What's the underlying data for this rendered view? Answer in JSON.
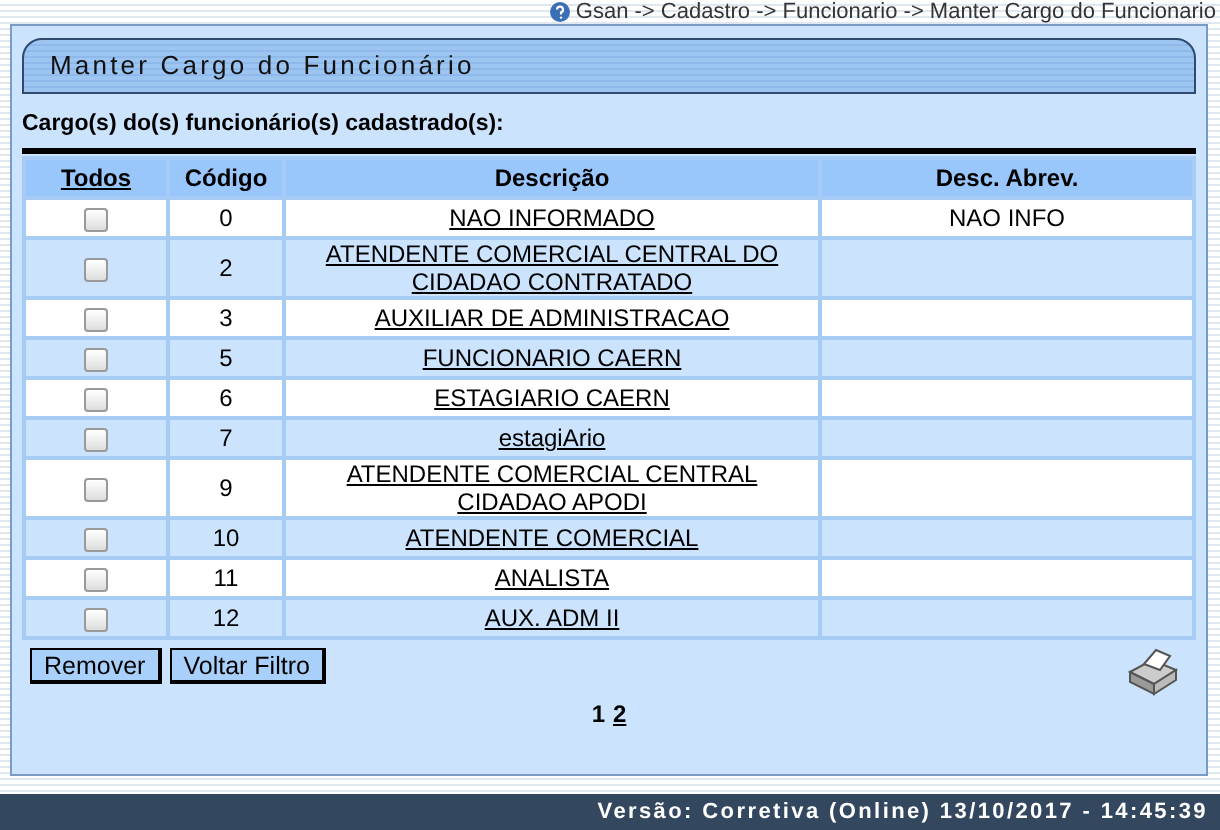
{
  "breadcrumb": "Gsan -> Cadastro -> Funcionario -> Manter Cargo do Funcionario",
  "title": "Manter Cargo do Funcionário",
  "subtitle": "Cargo(s) do(s) funcionário(s) cadastrado(s):",
  "table": {
    "columns": [
      "Todos",
      "Código",
      "Descrição",
      "Desc. Abrev."
    ],
    "rows": [
      {
        "checked": false,
        "code": "0",
        "description": "NAO INFORMADO",
        "abbrev": "NAO INFO"
      },
      {
        "checked": false,
        "code": "2",
        "description": "ATENDENTE COMERCIAL CENTRAL DO CIDADAO CONTRATADO"
      },
      {
        "checked": false,
        "code": "3",
        "description": "AUXILIAR DE ADMINISTRACAO"
      },
      {
        "checked": false,
        "code": "5",
        "description": "FUNCIONARIO CAERN"
      },
      {
        "checked": false,
        "code": "6",
        "description": "ESTAGIARIO CAERN"
      },
      {
        "checked": false,
        "code": "7",
        "description": "estagiArio"
      },
      {
        "checked": false,
        "code": "9",
        "description": "ATENDENTE COMERCIAL CENTRAL CIDADAO APODI"
      },
      {
        "checked": false,
        "code": "10",
        "description": "ATENDENTE COMERCIAL"
      },
      {
        "checked": false,
        "code": "11",
        "description": "ANALISTA"
      },
      {
        "checked": false,
        "code": "12",
        "description": "AUX. ADM II"
      }
    ]
  },
  "buttons": [
    "Remover",
    "Voltar Filtro"
  ],
  "pages": [
    {
      "label": "1",
      "selected": true
    },
    {
      "label": "2",
      "selected": false
    }
  ],
  "footer": "Versão: Corretiva (Online) 13/10/2017 - 14:45:39"
}
